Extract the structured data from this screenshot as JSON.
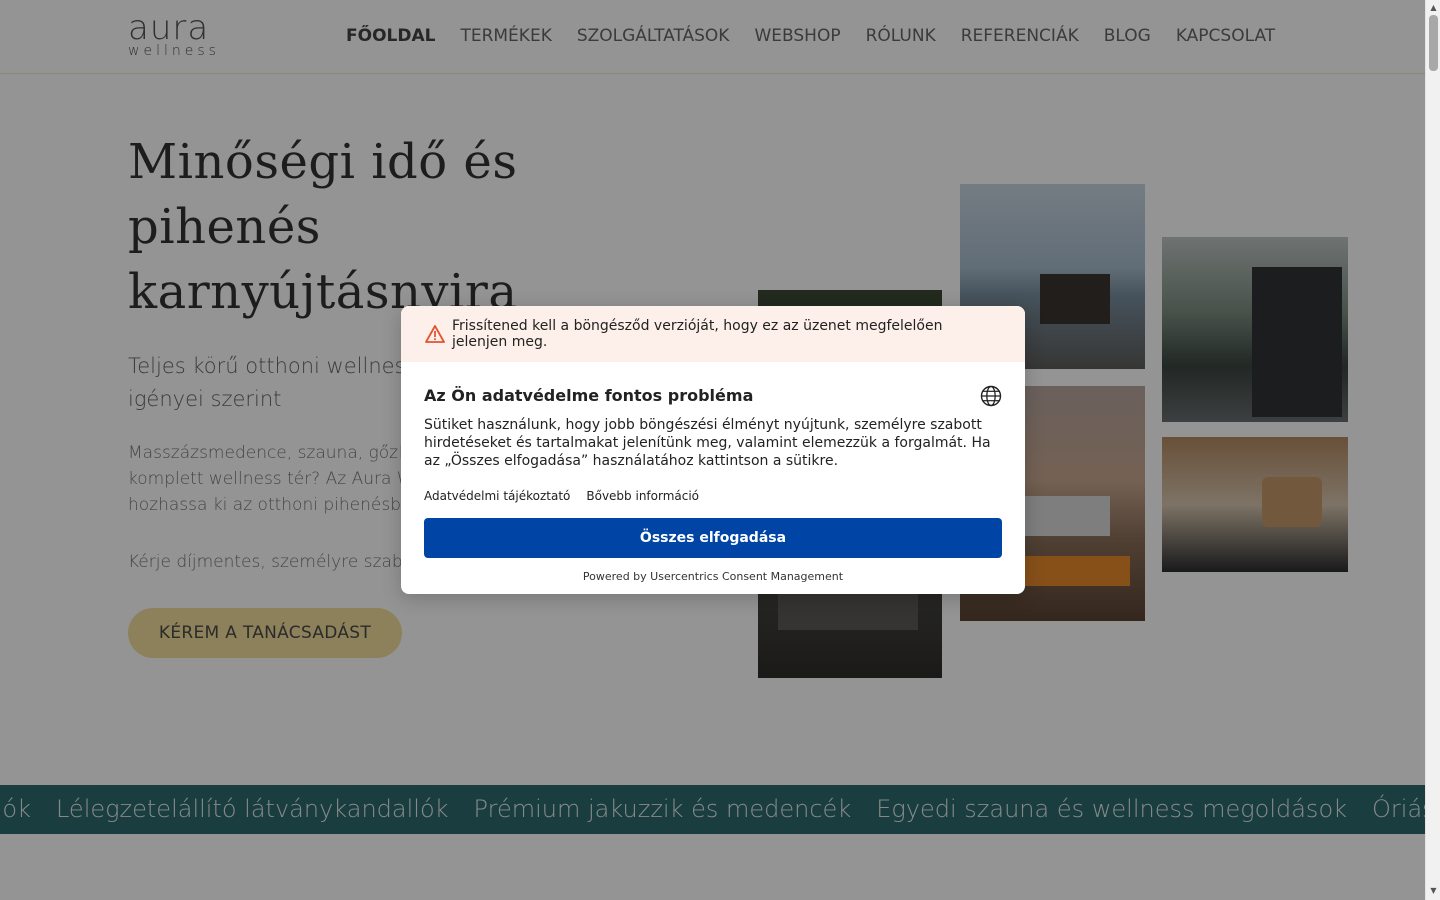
{
  "header": {
    "logo_main": "aura",
    "logo_sub": "wellness",
    "nav": [
      "FŐOLDAL",
      "TERMÉKEK",
      "SZOLGÁLTATÁSOK",
      "WEBSHOP",
      "RÓLUNK",
      "REFERENCIÁK",
      "BLOG",
      "KAPCSOLAT"
    ],
    "active_nav": "FŐOLDAL"
  },
  "hero": {
    "title_lines": [
      "Minőségi idő és",
      "pihenés",
      "karnyújtásnyira"
    ],
    "subtitle": "Teljes körű otthoni wellness megoldások az Ön igényei szerint",
    "body": "Masszázsmedence, szauna, gőzkabin, látványkandalló vagy egy komplett wellness tér? Az Aura Wellness segít, hogy a legtöbbet hozhassa ki az otthoni pihenésből.",
    "cta_text": "Kérje díjmentes, személyre szabott tanácsadásunkat!",
    "cta_button": "KÉREM A TANÁCSADÁST"
  },
  "ticker": {
    "items": [
      "kolók",
      "Lélegzetelállító látványkandallók",
      "Prémium jakuzzik és medencék",
      "Egyedi szauna és wellness megoldások",
      "Óriási grill"
    ]
  },
  "consent": {
    "warning": "Frissítened kell a böngésződ verzióját, hogy ez az üzenet megfelelően jelenjen meg.",
    "title": "Az Ön adatvédelme fontos probléma",
    "body": "Sütiket használunk, hogy jobb böngészési élményt nyújtunk, személyre szabott hirdetéseket és tartalmakat jelenítünk meg, valamint elemezzük a forgalmát. Ha az „Összes elfogadása” használatához kattintson a sütikre.",
    "link_privacy": "Adatvédelmi tájékoztató",
    "link_more": "Bővebb információ",
    "accept_button": "Összes elfogadása",
    "powered_by": "Powered by Usercentrics Consent Management"
  },
  "colors": {
    "cta": "#f2de9c",
    "ticker_bg": "#2e6b6f",
    "accept": "#0045a5",
    "warning_bg": "#fdefe9",
    "warning_icon": "#e2542e"
  },
  "icons": {
    "warning": "warning-triangle-icon",
    "language": "globe-icon"
  }
}
